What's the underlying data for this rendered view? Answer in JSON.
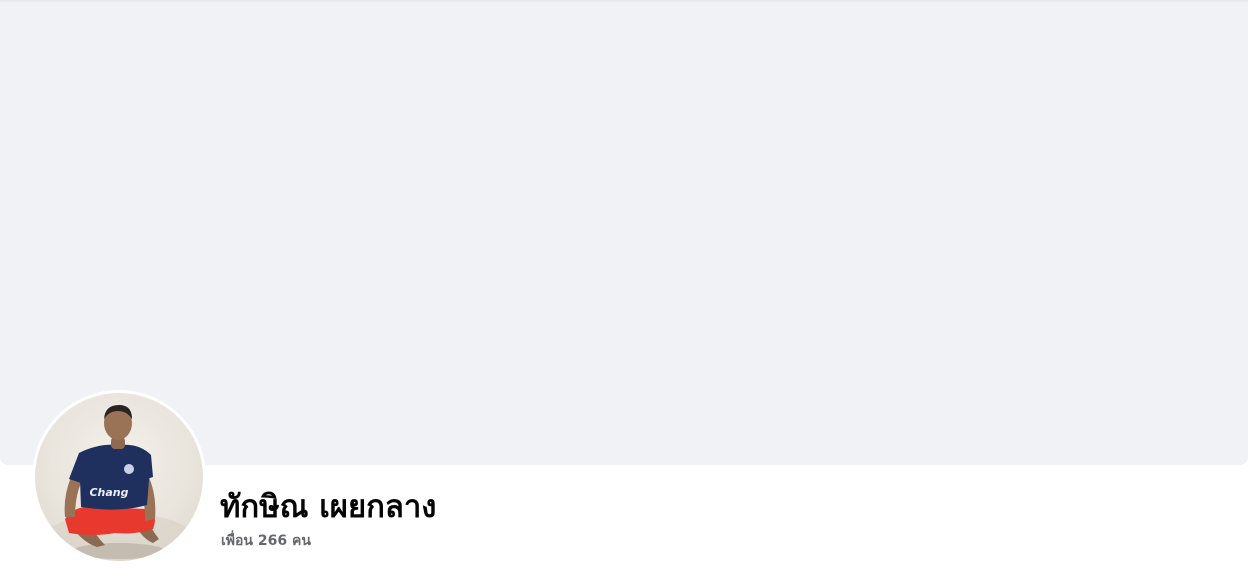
{
  "profile": {
    "name": "ทักษิณ เผยกลาง",
    "friends_text": "เพื่อน 266 คน",
    "avatar_icon": "profile-photo",
    "jersey_text": "Chang"
  },
  "colors": {
    "cover_background": "#f0f2f5",
    "name_text": "#050505",
    "secondary_text": "#65676b",
    "jersey": "#1f2f5e",
    "shorts": "#e8392f"
  }
}
